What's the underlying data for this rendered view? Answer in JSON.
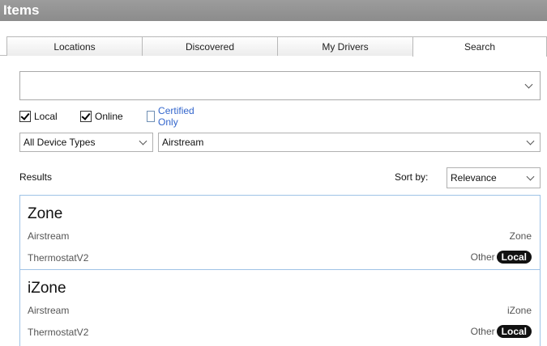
{
  "window": {
    "title": "Items"
  },
  "tabs": [
    {
      "label": "Locations",
      "active": false
    },
    {
      "label": "Discovered",
      "active": false
    },
    {
      "label": "My Drivers",
      "active": false
    },
    {
      "label": "Search",
      "active": true
    }
  ],
  "search": {
    "value": ""
  },
  "filters": {
    "local": {
      "label": "Local",
      "checked": true
    },
    "online": {
      "label": "Online",
      "checked": true
    },
    "certified": {
      "label": "Certified Only",
      "checked": false
    },
    "device_type": {
      "selected": "All Device Types"
    },
    "manufacturer": {
      "selected": "Airstream"
    }
  },
  "results": {
    "label": "Results",
    "sort_label": "Sort by:",
    "sort_selected": "Relevance",
    "items": [
      {
        "name": "Zone",
        "manufacturer": "Airstream",
        "model": "ThermostatV2",
        "type": "Zone",
        "category": "Other",
        "badge": "Local"
      },
      {
        "name": "iZone",
        "manufacturer": "Airstream",
        "model": "ThermostatV2",
        "type": "iZone",
        "category": "Other",
        "badge": "Local"
      }
    ]
  },
  "colors": {
    "titlebar": "#959595",
    "link_blue": "#3366cc",
    "list_border": "#9fc3e6",
    "badge_bg": "#111111"
  },
  "icons": [
    "chevron-down-icon",
    "checkmark-icon"
  ]
}
